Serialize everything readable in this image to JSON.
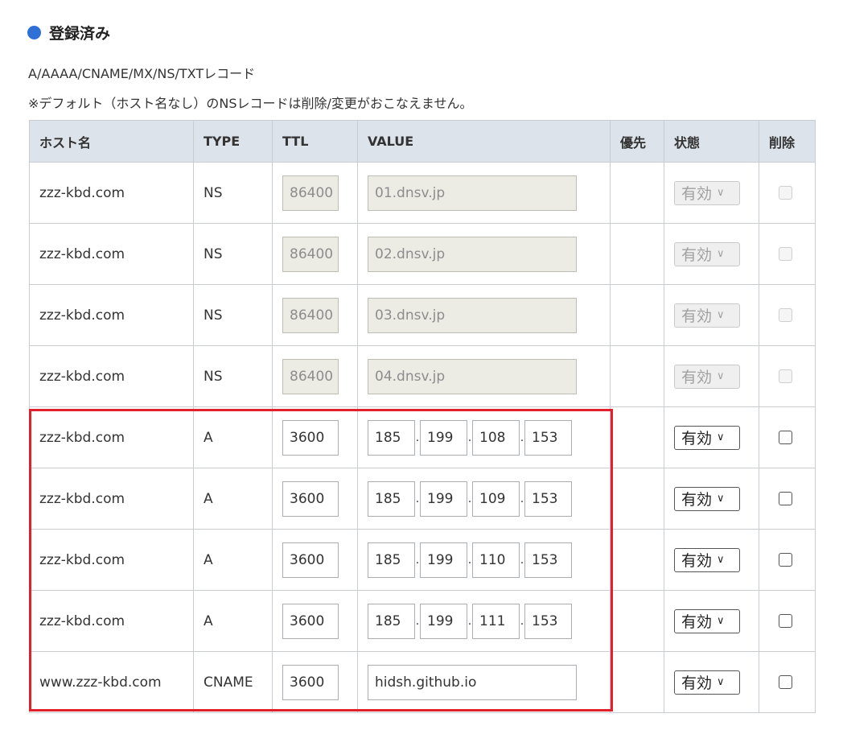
{
  "section": {
    "title": "登録済み"
  },
  "description": {
    "line1": "A/AAAA/CNAME/MX/NS/TXTレコード",
    "line2": "※デフォルト（ホスト名なし）のNSレコードは削除/変更がおこなえません。"
  },
  "table": {
    "headers": [
      "ホスト名",
      "TYPE",
      "TTL",
      "VALUE",
      "優先",
      "状態",
      "削除"
    ],
    "rows": [
      {
        "host": "zzz-kbd.com",
        "type": "NS",
        "ttl": "86400",
        "value": "01.dnsv.jp",
        "priority": "",
        "status": "有効",
        "disabled": true
      },
      {
        "host": "zzz-kbd.com",
        "type": "NS",
        "ttl": "86400",
        "value": "02.dnsv.jp",
        "priority": "",
        "status": "有効",
        "disabled": true
      },
      {
        "host": "zzz-kbd.com",
        "type": "NS",
        "ttl": "86400",
        "value": "03.dnsv.jp",
        "priority": "",
        "status": "有効",
        "disabled": true
      },
      {
        "host": "zzz-kbd.com",
        "type": "NS",
        "ttl": "86400",
        "value": "04.dnsv.jp",
        "priority": "",
        "status": "有効",
        "disabled": true
      },
      {
        "host": "zzz-kbd.com",
        "type": "A",
        "ttl": "3600",
        "octets": [
          "185",
          "199",
          "108",
          "153"
        ],
        "priority": "",
        "status": "有効",
        "disabled": false
      },
      {
        "host": "zzz-kbd.com",
        "type": "A",
        "ttl": "3600",
        "octets": [
          "185",
          "199",
          "109",
          "153"
        ],
        "priority": "",
        "status": "有効",
        "disabled": false
      },
      {
        "host": "zzz-kbd.com",
        "type": "A",
        "ttl": "3600",
        "octets": [
          "185",
          "199",
          "110",
          "153"
        ],
        "priority": "",
        "status": "有効",
        "disabled": false
      },
      {
        "host": "zzz-kbd.com",
        "type": "A",
        "ttl": "3600",
        "octets": [
          "185",
          "199",
          "111",
          "153"
        ],
        "priority": "",
        "status": "有効",
        "disabled": false
      },
      {
        "host": "www.zzz-kbd.com",
        "type": "CNAME",
        "ttl": "3600",
        "value": "hidsh.github.io",
        "priority": "",
        "status": "有効",
        "disabled": false
      }
    ]
  },
  "colors": {
    "bullet": "#2f6fd6",
    "highlight": "#e0202a",
    "header_bg": "#dde3eb",
    "disabled_field": "#ecebe4"
  }
}
